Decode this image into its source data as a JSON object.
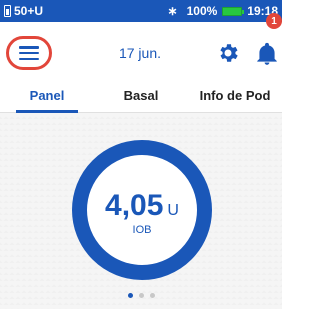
{
  "status_bar": {
    "left_text": "50+U",
    "battery_percent": "100%",
    "time": "19:18",
    "icons": [
      "pod-battery-icon",
      "bluetooth-icon",
      "battery-icon"
    ]
  },
  "header": {
    "date": "17 jun.",
    "notification_count": "1",
    "icons": [
      "menu-icon",
      "gear-icon",
      "bell-icon"
    ],
    "highlight_color": "#e2463a"
  },
  "tabs": [
    {
      "label": "Panel",
      "active": true
    },
    {
      "label": "Basal",
      "active": false
    },
    {
      "label": "Info de Pod",
      "active": false
    }
  ],
  "dashboard": {
    "iob_value": "4,05",
    "iob_unit": "U",
    "iob_label": "IOB",
    "page_count": 3,
    "active_page": 1
  },
  "colors": {
    "primary": "#1a57b8",
    "alert": "#e2463a",
    "battery": "#28c840"
  }
}
